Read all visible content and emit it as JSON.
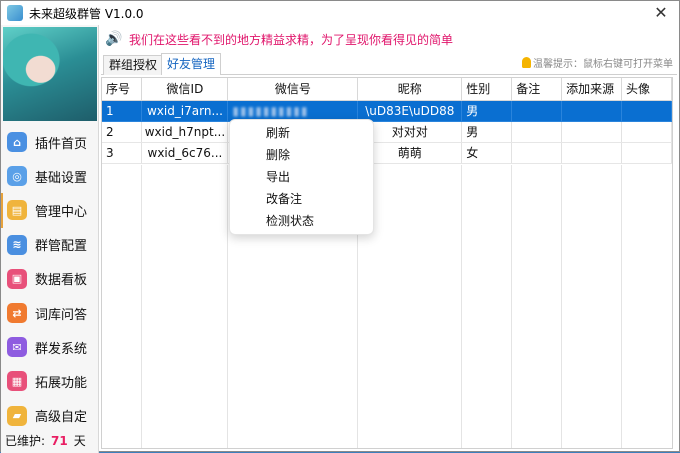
{
  "window": {
    "title": "未来超级群管 V1.0.0",
    "close_glyph": "✕"
  },
  "sidebar": {
    "items": [
      {
        "label": "插件首页",
        "icon": "home-icon",
        "color": "#4a90e2"
      },
      {
        "label": "基础设置",
        "icon": "settings-icon",
        "color": "#5aa0e8"
      },
      {
        "label": "管理中心",
        "icon": "note-icon",
        "color": "#f0b43c"
      },
      {
        "label": "群管配置",
        "icon": "layers-icon",
        "color": "#4a8fe0"
      },
      {
        "label": "数据看板",
        "icon": "bag-icon",
        "color": "#e8507a"
      },
      {
        "label": "词库问答",
        "icon": "swap-icon",
        "color": "#f07a30"
      },
      {
        "label": "群发系统",
        "icon": "send-icon",
        "color": "#8e5ce0"
      },
      {
        "label": "拓展功能",
        "icon": "grid-icon",
        "color": "#e8507a"
      },
      {
        "label": "高级自定",
        "icon": "folder-icon",
        "color": "#f0b43c"
      }
    ],
    "maintained_label": "已维护:",
    "maintained_days": "71",
    "maintained_unit": "天"
  },
  "notice": {
    "text": "我们在这些看不到的地方精益求精，为了呈现你看得见的简单"
  },
  "tabs": [
    {
      "label": "群组授权"
    },
    {
      "label": "好友管理"
    }
  ],
  "hint": {
    "text": "温馨提示：鼠标右键可打开菜单"
  },
  "table": {
    "columns": [
      "序号",
      "微信ID",
      "微信号",
      "昵称",
      "性别",
      "备注",
      "添加来源",
      "头像"
    ],
    "rows": [
      [
        "1",
        "wxid_i7arn...",
        "",
        "\\uD83E\\uDD88",
        "男",
        "",
        "",
        ""
      ],
      [
        "2",
        "wxid_h7npt...",
        "",
        "对对对",
        "男",
        "",
        "",
        ""
      ],
      [
        "3",
        "wxid_6c76...",
        "",
        "萌萌",
        "女",
        "",
        "",
        ""
      ]
    ]
  },
  "context_menu": {
    "items": [
      "刷新",
      "删除",
      "导出",
      "改备注",
      "检测状态"
    ]
  }
}
